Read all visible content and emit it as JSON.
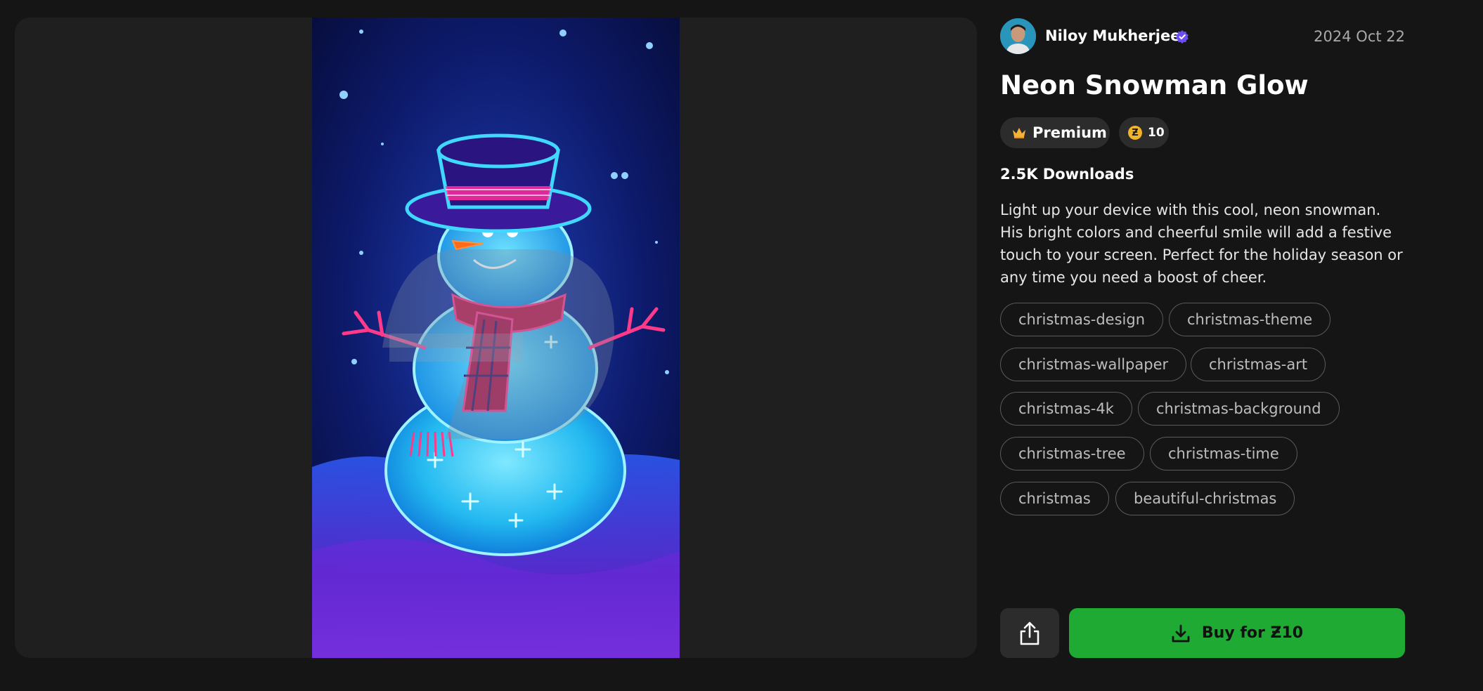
{
  "author": {
    "name": "Niloy Mukherjee",
    "avatar_icon": "avatar",
    "verified_icon": "verified-badge-icon"
  },
  "date": "2024 Oct 22",
  "title": "Neon Snowman Glow",
  "badges": {
    "premium_label": "Premium",
    "premium_icon": "crown-icon",
    "coin_symbol": "Ƶ",
    "coin_amount": "10"
  },
  "downloads": "2.5K Downloads",
  "description": "Light up your device with this cool, neon snowman. His bright colors and cheerful smile will add a festive touch to your screen. Perfect for the holiday season or any time you need a boost of cheer.",
  "tags": [
    "christmas-design",
    "christmas-theme",
    "christmas-wallpaper",
    "christmas-art",
    "christmas-4k",
    "christmas-background",
    "christmas-tree",
    "christmas-time",
    "christmas",
    "beautiful-christmas"
  ],
  "actions": {
    "share_icon": "share-icon",
    "buy_label": "Buy for Ƶ10",
    "buy_icon": "download-icon"
  },
  "colors": {
    "page_bg": "#151515",
    "panel_bg": "#1f1f1f",
    "accent_green": "#1fab33",
    "verified_purple": "#6c4cf5",
    "coin_gold": "#f0b429"
  }
}
